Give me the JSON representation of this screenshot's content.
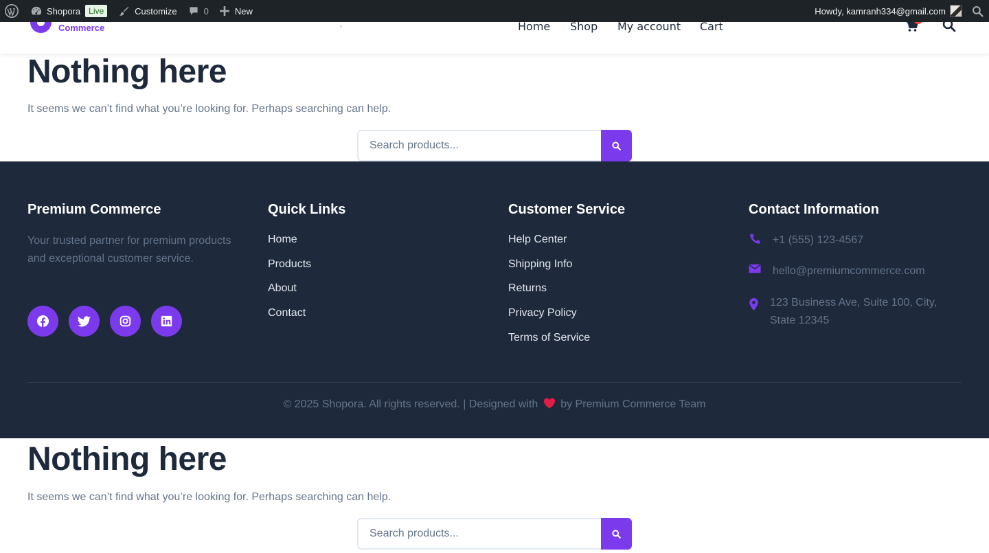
{
  "adminbar": {
    "site_name": "Shopora",
    "live_badge": "Live",
    "customize_label": "Customize",
    "comments_count": "0",
    "new_label": "New",
    "howdy": "Howdy, kamranh334@gmail.com"
  },
  "header": {
    "logo_subtitle": "Commerce",
    "nav": [
      "Home",
      "Shop",
      "My account",
      "Cart"
    ]
  },
  "notfound": {
    "title": "Nothing here",
    "message": "It seems we can’t find what you’re looking for. Perhaps searching can help.",
    "search_placeholder": "Search products..."
  },
  "footer": {
    "brand_title": "Premium Commerce",
    "about": "Your trusted partner for premium products and exceptional customer service.",
    "socials": [
      "facebook-icon",
      "twitter-icon",
      "instagram-icon",
      "linkedin-icon"
    ],
    "quick_links_title": "Quick Links",
    "quick_links": [
      "Home",
      "Products",
      "About",
      "Contact"
    ],
    "service_title": "Customer Service",
    "service_links": [
      "Help Center",
      "Shipping Info",
      "Returns",
      "Privacy Policy",
      "Terms of Service"
    ],
    "contact_title": "Contact Information",
    "phone": "+1 (555) 123-4567",
    "email": "hello@premiumcommerce.com",
    "address": "123 Business Ave, Suite 100, City, State 12345",
    "copyright_left": "© 2025 Shopora. All rights reserved. | Designed with",
    "copyright_right": "by Premium Commerce Team"
  },
  "colors": {
    "accent": "#7c3aed",
    "footer_bg": "#1e293b",
    "heart": "#e11d48"
  }
}
